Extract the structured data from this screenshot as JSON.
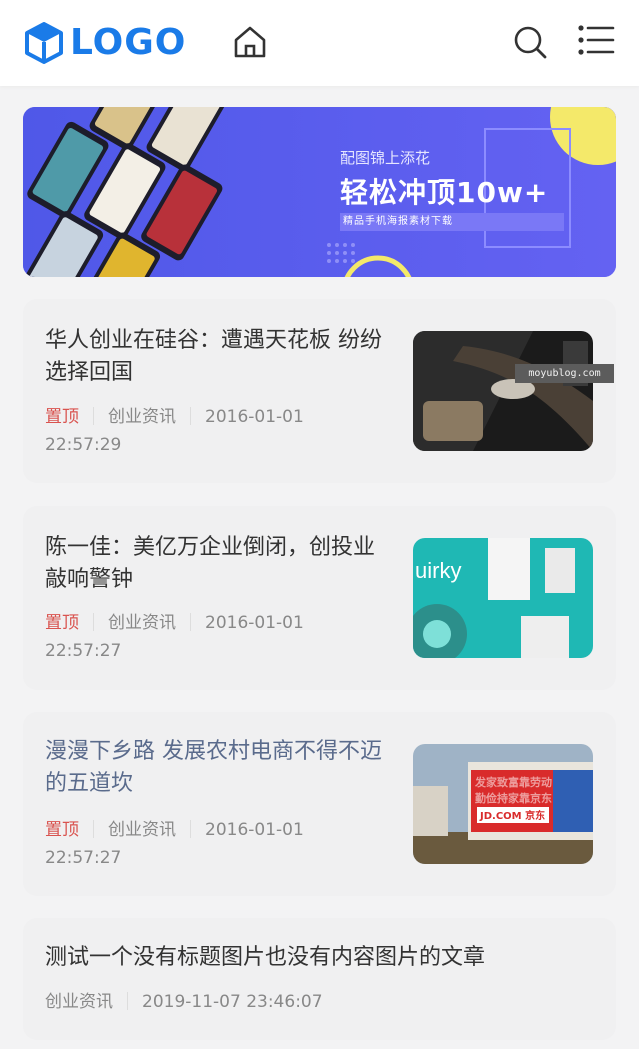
{
  "header": {
    "logo_text": "LOGO",
    "icons": [
      "cube-logo-icon",
      "home-icon",
      "search-icon",
      "menu-list-icon"
    ]
  },
  "banner": {
    "subtitle": "配图锦上添花",
    "headline": "轻松冲顶10w+",
    "tagline": "精品手机海报素材下载"
  },
  "articles": [
    {
      "title": "华人创业在硅谷：遭遇天花板 纷纷选择回国",
      "pinned": "置顶",
      "category": "创业资讯",
      "date": "2016-01-01",
      "time": "22:57:29",
      "has_image": true
    },
    {
      "title": "陈一佳：美亿万企业倒闭，创投业敲响警钟",
      "pinned": "置顶",
      "category": "创业资讯",
      "date": "2016-01-01",
      "time": "22:57:27",
      "has_image": true
    },
    {
      "title": "漫漫下乡路 发展农村电商不得不迈的五道坎",
      "pinned": "置顶",
      "category": "创业资讯",
      "date": "2016-01-01",
      "time": "22:57:27",
      "has_image": true
    },
    {
      "title": "测试一个没有标题图片也没有内容图片的文章",
      "category": "创业资讯",
      "datetime": "2019-11-07 23:46:07",
      "has_image": false
    }
  ],
  "thumb_texts": {
    "quirky": "uirky",
    "sign_line1": "发家致富靠劳动",
    "sign_line2": "勤俭持家靠京东",
    "sign_line3": "JD.COM 京东"
  },
  "watermark": "moyublog.com",
  "colors": {
    "brand": "#1a7be8",
    "pinned": "#d9534f",
    "banner": "#5b5cf0"
  }
}
